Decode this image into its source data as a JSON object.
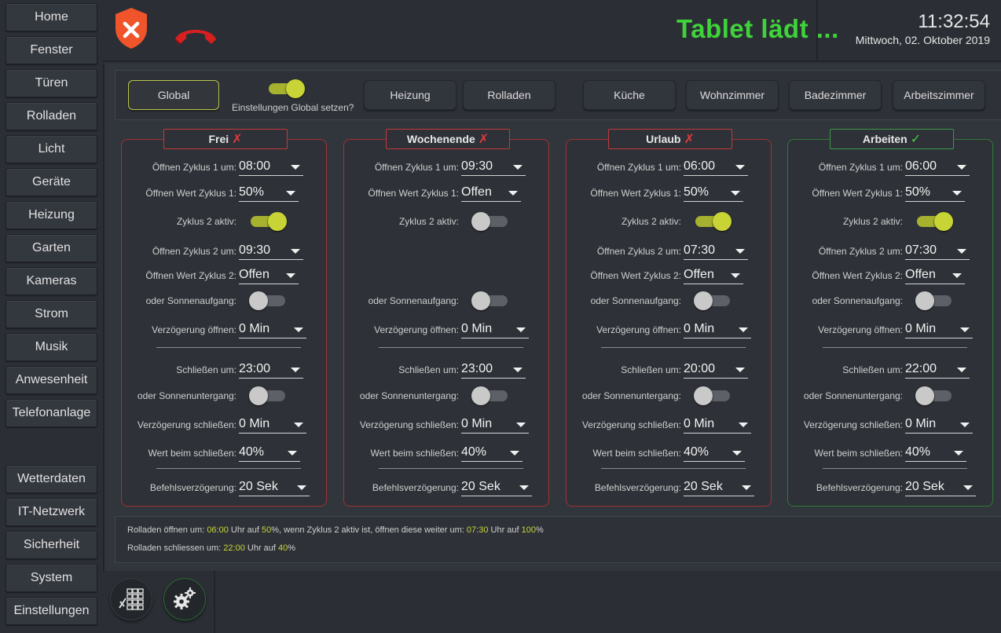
{
  "nav": {
    "items": [
      "Home",
      "Fenster",
      "Türen",
      "Rolladen",
      "Licht",
      "Geräte",
      "Heizung",
      "Garten",
      "Kameras",
      "Strom",
      "Musik",
      "Anwesenheit",
      "Telefonanlage"
    ],
    "bottom_items": [
      "Wetterdaten",
      "IT-Netzwerk",
      "Sicherheit",
      "System",
      "Einstellungen"
    ]
  },
  "header": {
    "status_text": "Tablet lädt ...",
    "time": "11:32:54",
    "date": "Mittwoch, 02. Oktober 2019",
    "icons": [
      "shield-alert-icon",
      "phone-hangup-icon"
    ],
    "colors": {
      "status": "#3fd33a",
      "shield": "#f0542a",
      "phone": "#d81f1f"
    }
  },
  "tabs": {
    "global": "Global",
    "global_toggle_label": "Einstellungen Global setzen?",
    "global_toggle_on": true,
    "items": [
      "Heizung",
      "Rolladen",
      "Küche",
      "Wohnzimmer",
      "Badezimmer",
      "Arbeitszimmer"
    ]
  },
  "labels": {
    "open_cycle1": "Öffnen Zyklus 1 um:",
    "open_value1": "Öffnen Wert Zyklus 1:",
    "cycle2_active": "Zyklus 2 aktiv:",
    "open_cycle2": "Öffnen Zyklus 2 um:",
    "open_value2": "Öffnen Wert Zyklus 2:",
    "sunrise": "oder Sonnenaufgang:",
    "delay_open": "Verzögerung öffnen:",
    "close_at": "Schließen um:",
    "sunset": "oder Sonnenuntergang:",
    "delay_close": "Verzögerung schließen:",
    "value_close": "Wert beim schließen:",
    "cmd_delay": "Befehlsverzögerung:"
  },
  "panels": [
    {
      "title": "Frei",
      "status_mark": "✗",
      "active": false,
      "open_cycle1": "08:00",
      "open_value1": "50%",
      "cycle2_active": true,
      "open_cycle2": "09:30",
      "open_value2": "Offen",
      "sunrise": false,
      "delay_open": "0 Min",
      "close_at": "23:00",
      "sunset": false,
      "delay_close": "0 Min",
      "value_close": "40%",
      "cmd_delay": "20 Sek"
    },
    {
      "title": "Wochenende",
      "status_mark": "✗",
      "active": false,
      "open_cycle1": "09:30",
      "open_value1": "Offen",
      "cycle2_active": false,
      "open_cycle2": "",
      "open_value2": "",
      "sunrise": false,
      "delay_open": "0 Min",
      "close_at": "23:00",
      "sunset": false,
      "delay_close": "0 Min",
      "value_close": "40%",
      "cmd_delay": "20 Sek"
    },
    {
      "title": "Urlaub",
      "status_mark": "✗",
      "active": false,
      "open_cycle1": "06:00",
      "open_value1": "50%",
      "cycle2_active": true,
      "open_cycle2": "07:30",
      "open_value2": "Offen",
      "sunrise": false,
      "delay_open": "0 Min",
      "close_at": "20:00",
      "sunset": false,
      "delay_close": "0 Min",
      "value_close": "40%",
      "cmd_delay": "20 Sek"
    },
    {
      "title": "Arbeiten",
      "status_mark": "✓",
      "active": true,
      "open_cycle1": "06:00",
      "open_value1": "50%",
      "cycle2_active": true,
      "open_cycle2": "07:30",
      "open_value2": "Offen",
      "sunrise": false,
      "delay_open": "0 Min",
      "close_at": "22:00",
      "sunset": false,
      "delay_close": "0 Min",
      "value_close": "40%",
      "cmd_delay": "20 Sek"
    }
  ],
  "summary": {
    "line1": {
      "p1": "Rolladen öffnen um: ",
      "t1": "06:00",
      "p2": " Uhr auf ",
      "v1": "50",
      "p3": "%, wenn Zyklus 2 aktiv ist, öffnen diese weiter um: ",
      "t2": "07:30",
      "p4": " Uhr auf ",
      "v2": "100",
      "p5": "%"
    },
    "line2": {
      "p1": "Rolladen schliessen um: ",
      "t1": "22:00",
      "p2": " Uhr auf ",
      "v1": "40",
      "p3": "%"
    }
  },
  "bottom": {
    "icons": [
      "keypad-icon",
      "gears-icon"
    ]
  }
}
